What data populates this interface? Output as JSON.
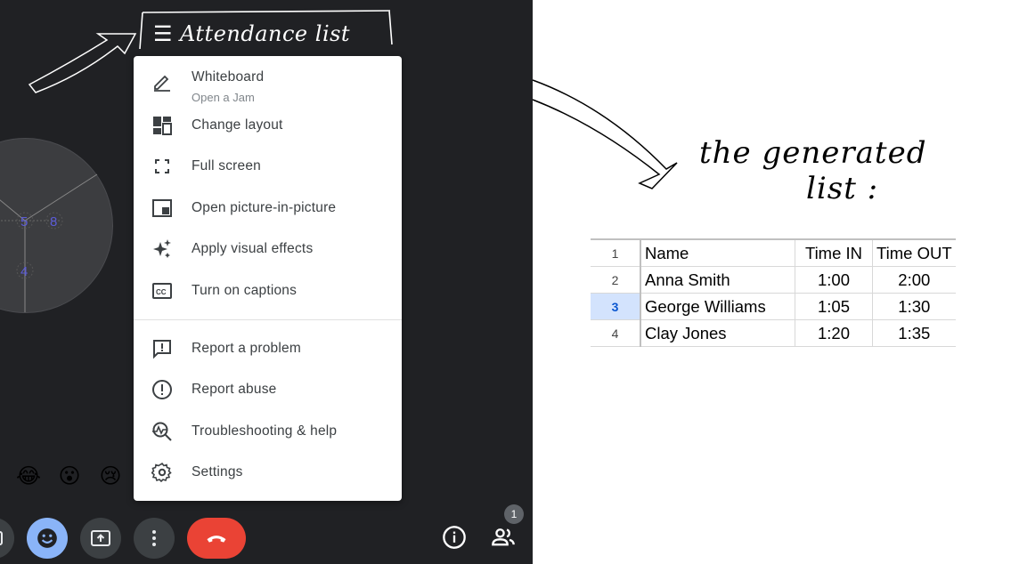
{
  "annotations": {
    "attendance_title": "Attendance list",
    "generated_line1": "the generated",
    "generated_line2": "list :"
  },
  "menu": {
    "items": [
      {
        "icon": "pencil-icon",
        "label": "Whiteboard",
        "sublabel": "Open a Jam"
      },
      {
        "icon": "layout-icon",
        "label": "Change layout"
      },
      {
        "icon": "fullscreen-icon",
        "label": "Full screen"
      },
      {
        "icon": "picture-in-picture-icon",
        "label": "Open picture-in-picture"
      },
      {
        "icon": "sparkle-icon",
        "label": "Apply visual effects"
      },
      {
        "icon": "captions-icon",
        "label": "Turn on captions"
      },
      {
        "icon": "report-problem-icon",
        "label": "Report a problem"
      },
      {
        "icon": "report-abuse-icon",
        "label": "Report abuse"
      },
      {
        "icon": "troubleshoot-icon",
        "label": "Troubleshooting & help"
      },
      {
        "icon": "settings-icon",
        "label": "Settings"
      }
    ]
  },
  "reactions": [
    "😂",
    "😮",
    "😢"
  ],
  "controls": {
    "people_count": "1"
  },
  "dial_labels": [
    "5",
    "8",
    "4"
  ],
  "sheet": {
    "row_numbers": [
      "1",
      "2",
      "3",
      "4"
    ],
    "active_row": "3",
    "rows": [
      [
        "Name",
        "Time IN",
        "Time OUT"
      ],
      [
        "Anna Smith",
        "1:00",
        "2:00"
      ],
      [
        "George Williams",
        "1:05",
        "1:30"
      ],
      [
        "Clay Jones",
        "1:20",
        "1:35"
      ]
    ]
  },
  "colors": {
    "meet_bg": "#202124",
    "control_bg": "#3c4043",
    "reactions_active": "#8ab4f8",
    "end_call": "#ea4335",
    "active_row_bg": "#d3e3fd"
  }
}
